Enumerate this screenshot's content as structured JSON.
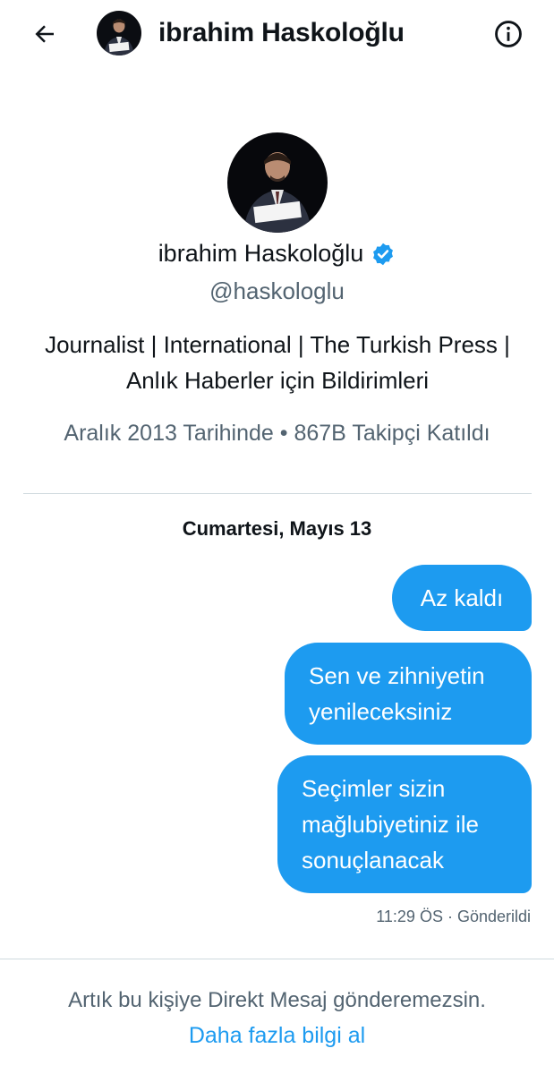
{
  "header": {
    "name": "ibrahim Haskoloğlu",
    "back_icon": "arrow-left-icon",
    "info_icon": "info-circle-icon"
  },
  "profile": {
    "name": "ibrahim Haskoloğlu",
    "verified_icon": "verified-badge-icon",
    "handle": "@haskologlu",
    "bio": "Journalist | International | The Turkish Press | Anlık Haberler için Bildirimleri",
    "meta": "Aralık 2013 Tarihinde • 867B Takipçi Katıldı"
  },
  "conversation": {
    "date": "Cumartesi, Mayıs 13",
    "messages": [
      {
        "text": "Az kaldı"
      },
      {
        "text": "Sen ve zihniyetin yenileceksiniz"
      },
      {
        "text": "Seçimler sizin mağlubiyetiniz ile sonuçlanacak"
      }
    ],
    "status": "11:29 ÖS · Gönderildi"
  },
  "footer": {
    "notice": "Artık bu kişiye Direkt Mesaj gönderemezsin.",
    "link": "Daha fazla bilgi al"
  },
  "colors": {
    "accent": "#1d9bf0",
    "text_primary": "#0f1419",
    "text_secondary": "#536471",
    "divider": "#cfd9de"
  }
}
